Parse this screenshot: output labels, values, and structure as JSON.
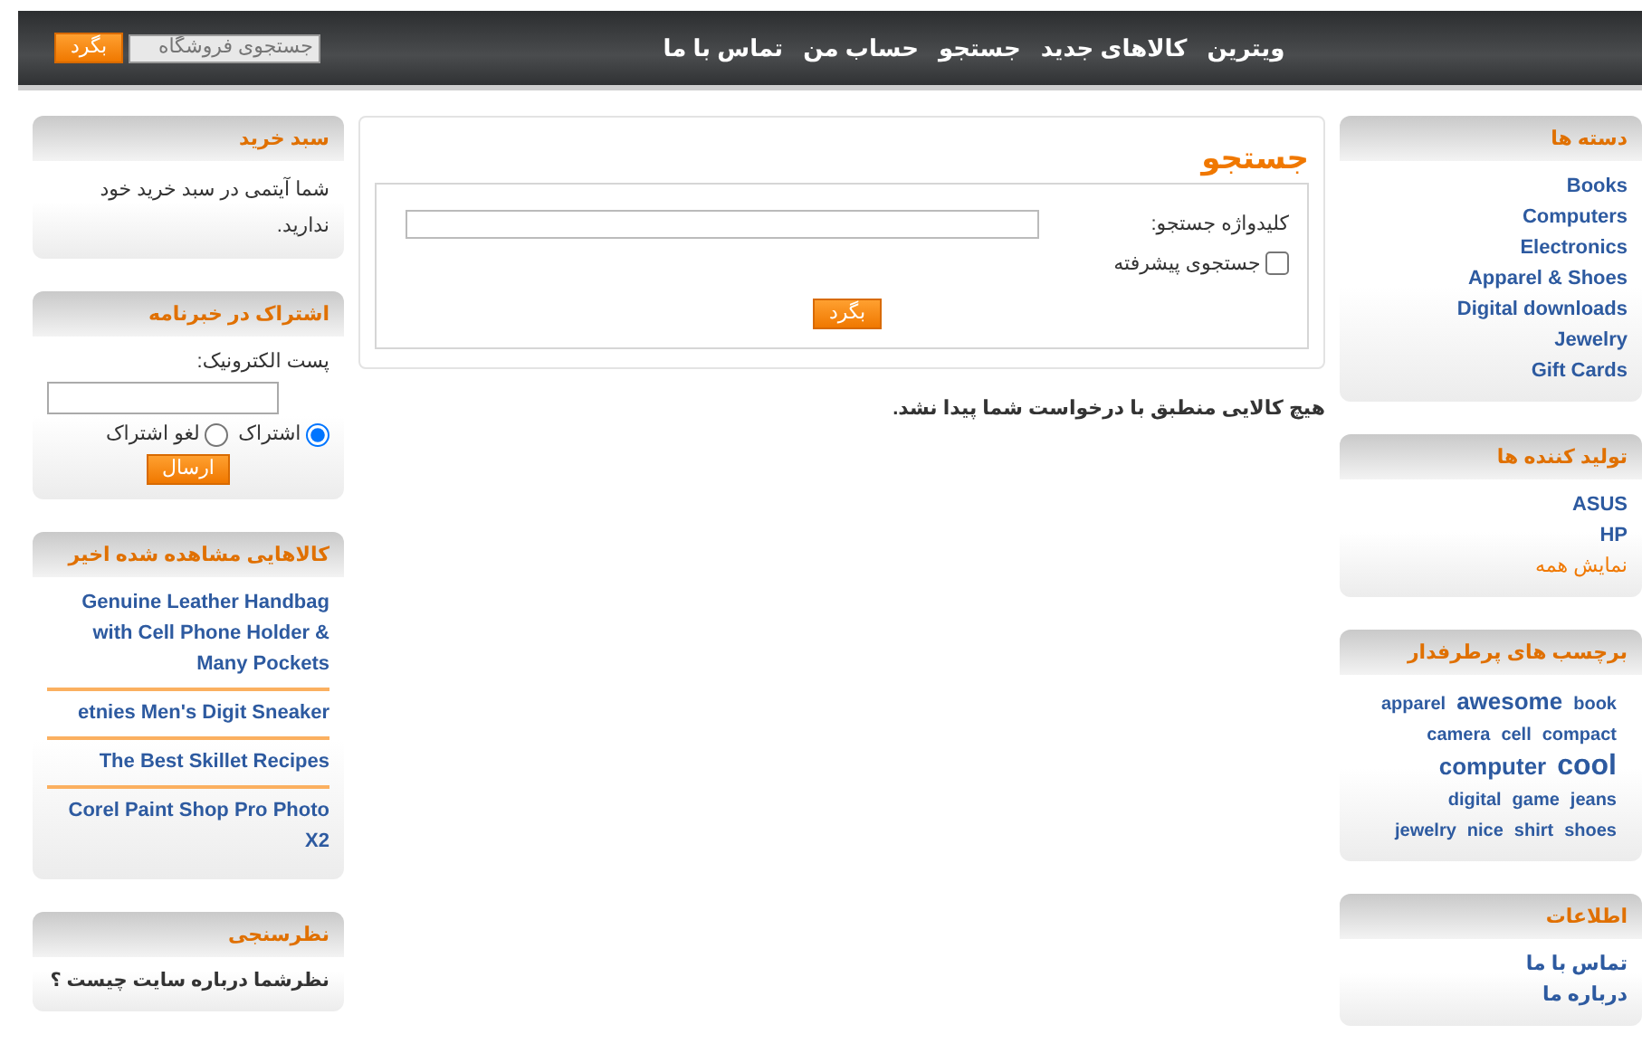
{
  "header": {
    "menu": [
      {
        "label": "ویترین"
      },
      {
        "label": "کالاهای جدید"
      },
      {
        "label": "جستجو"
      },
      {
        "label": "حساب من"
      },
      {
        "label": "تماس با ما"
      }
    ],
    "search": {
      "placeholder": "جستجوی فروشگاه",
      "button": "بگرد"
    }
  },
  "right_column": [
    {
      "kind": "links",
      "title": "دسته ها",
      "items": [
        {
          "label": "Books",
          "kind": "link"
        },
        {
          "label": "Computers",
          "kind": "link"
        },
        {
          "label": "Electronics",
          "kind": "link"
        },
        {
          "label": "Apparel & Shoes",
          "kind": "link"
        },
        {
          "label": "Digital downloads",
          "kind": "link"
        },
        {
          "label": "Jewelry",
          "kind": "link"
        },
        {
          "label": "Gift Cards",
          "kind": "link"
        }
      ]
    },
    {
      "kind": "links",
      "title": "تولید کننده ها",
      "items": [
        {
          "label": "ASUS",
          "kind": "link"
        },
        {
          "label": "HP",
          "kind": "link"
        },
        {
          "label": "نمایش همه",
          "kind": "more"
        }
      ]
    },
    {
      "kind": "tags",
      "title": "برچسب های پرطرفدار",
      "lines": [
        [
          {
            "label": "book",
            "kind": "small"
          },
          {
            "label": "awesome",
            "kind": "medium"
          },
          {
            "label": "apparel",
            "kind": "small"
          }
        ],
        [
          {
            "label": "compact",
            "kind": "small"
          },
          {
            "label": "cell",
            "kind": "small"
          },
          {
            "label": "camera",
            "kind": "small"
          }
        ],
        [
          {
            "label": "cool",
            "kind": "large"
          },
          {
            "label": "computer",
            "kind": "medium"
          }
        ],
        [
          {
            "label": "jeans",
            "kind": "small"
          },
          {
            "label": "game",
            "kind": "small"
          },
          {
            "label": "digital",
            "kind": "small"
          }
        ],
        [
          {
            "label": "shoes",
            "kind": "small"
          },
          {
            "label": "shirt",
            "kind": "small"
          },
          {
            "label": "nice",
            "kind": "small"
          },
          {
            "label": "jewelry",
            "kind": "small"
          }
        ]
      ]
    },
    {
      "kind": "links",
      "title": "اطلاعات",
      "items": [
        {
          "label": "تماس با ما",
          "kind": "link"
        },
        {
          "label": "درباره ما",
          "kind": "link"
        }
      ]
    }
  ],
  "main": {
    "title": "جستجو",
    "keyword_label": "کلیدواژه جستجو:",
    "advanced": {
      "label": "جستجوی پیشرفته",
      "checked": false
    },
    "button": "بگرد",
    "message": "هیچ کالایی منطبق با درخواست شما پیدا نشد."
  },
  "left_column": [
    {
      "kind": "text",
      "title": "سبد خرید",
      "text": "شما آیتمی در سبد خرید خود ندارید."
    },
    {
      "kind": "newsletter",
      "title": "اشتراک در خبرنامه",
      "email_label": "پست الکترونیک:",
      "options": [
        {
          "label": "اشتراک",
          "selected": true
        },
        {
          "label": "لغو اشتراک",
          "selected": false
        }
      ],
      "button": "ارسال"
    },
    {
      "kind": "recent",
      "title": "کالاهایی مشاهده شده اخیر",
      "items": [
        {
          "label": "Genuine Leather Handbag with Cell Phone Holder & Many Pockets"
        },
        {
          "label": "etnies Men's Digit Sneaker"
        },
        {
          "label": "The Best Skillet Recipes"
        },
        {
          "label": "Corel Paint Shop Pro Photo X2"
        }
      ]
    },
    {
      "kind": "poll",
      "title": "نظرسنجی",
      "question": "نظرشما درباره سایت چیست ؟"
    }
  ]
}
